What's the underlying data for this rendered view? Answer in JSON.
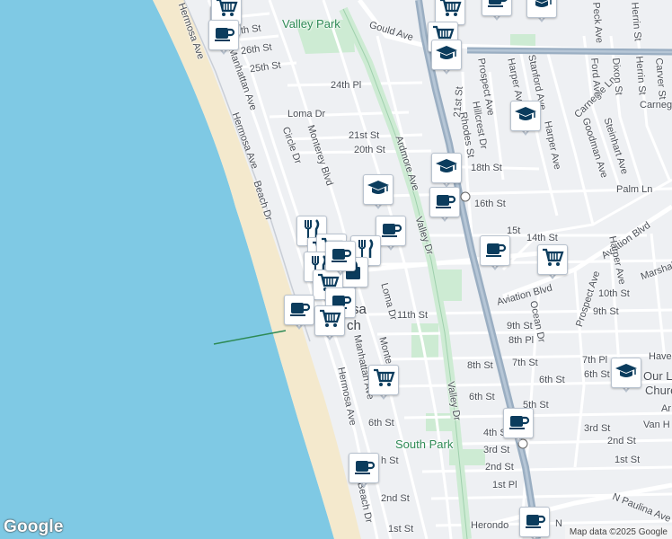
{
  "map": {
    "attribution": "Map data ©2025 Google",
    "logo": "Google",
    "colors": {
      "water": "#7fc9e4",
      "beach": "#f4e9cd",
      "land": "#eef0f3",
      "road": "#ffffff",
      "highway": "#9aaec2",
      "park": "#cdebd3",
      "marker_icon": "#0b3c5d",
      "marker_border": "#b9c3cf"
    },
    "places": {
      "valley_park": "Valley Park",
      "south_park": "South Park",
      "hermosa_beach_part1": "sa",
      "hermosa_beach_part2": "ch",
      "our_lady_church_1": "Our L",
      "our_lady_church_2": "Churc",
      "havel": "Have",
      "van_h": "Van H",
      "ar": "Ar"
    },
    "streets": {
      "hermosa_ave_top": "Hermosa Ave",
      "manhattan_ave_top": "Manhattan Ave",
      "st_27_partial": "th St",
      "st_26": "26th St",
      "st_25": "25th St",
      "gould_ave": "Gould Ave",
      "st_24": "24th Pl",
      "loma_dr_top": "Loma Dr",
      "circle_dr": "Circle Dr",
      "monterey_blvd": "Monterey Blvd",
      "hermosa_ave_mid": "Hermosa Ave",
      "beach_dr_mid": "Beach Dr",
      "st_21": "21st St",
      "st_20": "20th St",
      "ardmore_ave": "Ardmore Ave",
      "valley_dr_top": "Valley Dr",
      "st_21_b": "21st St",
      "hillcrest_dr": "Hillcrest Dr",
      "rhodes_st": "Rhodes St",
      "st_18": "18th St",
      "prospect_ave_top": "Prospect Ave",
      "harper_ave_1": "Harper Ave",
      "stanford_ave": "Stanford Ave",
      "harper_ave_2": "Harper Ave",
      "carnegie_ln": "Carnegie Ln",
      "goodman_ave": "Goodman Ave",
      "steinhart_ave": "Steinhart Ave",
      "ford_ave": "Ford Ave",
      "dixon_st": "Dixon St",
      "herrin_st_1": "Herrin St",
      "herrin_st_2": "Herrin St",
      "carver_st": "Carver St",
      "carnegie_r": "Carnegi",
      "peck_ave": "Peck Ave",
      "st_16": "16th St",
      "palm_ln": "Palm Ln",
      "st_14": "14th St",
      "st_15_partial": "15t",
      "aviation_blvd_1": "Aviation Blvd",
      "harper_ave_3": "Harper Ave",
      "marshall": "Marshal",
      "aviation_blvd_2": "Aviation Blvd",
      "st_10": "10th St",
      "prospect_ave_mid": "Prospect Ave",
      "st_9_r": "9th St",
      "ocean_dr": "Ocean Dr",
      "st_9": "9th St",
      "st_8_pl": "8th Pl",
      "st_11": "11th St",
      "loma_dr_mid": "Loma Dr",
      "monterey_mid": "Monte",
      "manhattan_ave_mid": "Manhattan Ave",
      "hermosa_ave_bot": "Hermosa Ave",
      "st_8": "8th St",
      "st_7": "7th St",
      "st_7_pl": "7th Pl",
      "st_6_a": "6th St",
      "st_6_b": "6th St",
      "st_6_c": "6th St",
      "st_6_d": "6th St",
      "st_5": "5th St",
      "st_4": "4th St",
      "st_3_a": "3rd St",
      "st_3_b": "3rd St",
      "st_2_a": "2nd St",
      "st_2_b": "2nd St",
      "st_2_c": "2nd St",
      "st_1_a": "1st Pl",
      "st_1_b": "1st St",
      "st_1_c": "1st St",
      "st_h_partial": "h St",
      "valley_dr_bot": "Valley Dr",
      "beach_dr_bot": "Beach Dr",
      "herondo": "Herondo",
      "n_paulina": "N Paulina Ave",
      "n_partial": "N"
    }
  },
  "markers": [
    {
      "kind": "cup-icon"
    },
    {
      "kind": "cart-icon"
    },
    {
      "kind": "cup-icon"
    },
    {
      "kind": "cart-icon"
    },
    {
      "kind": "cart-icon"
    },
    {
      "kind": "graduation-cap-icon"
    },
    {
      "kind": "cup-icon"
    },
    {
      "kind": "graduation-cap-icon"
    },
    {
      "kind": "graduation-cap-icon"
    },
    {
      "kind": "graduation-cap-icon"
    },
    {
      "kind": "graduation-cap-icon"
    },
    {
      "kind": "cup-icon"
    },
    {
      "kind": "cup-icon"
    },
    {
      "kind": "cup-icon"
    },
    {
      "kind": "cart-icon"
    },
    {
      "kind": "restaurant-icon"
    },
    {
      "kind": "cart-icon"
    },
    {
      "kind": "cart-icon"
    },
    {
      "kind": "restaurant-icon"
    },
    {
      "kind": "restaurant-icon"
    },
    {
      "kind": "shopping-bag-icon"
    },
    {
      "kind": "cart-icon"
    },
    {
      "kind": "cup-icon"
    },
    {
      "kind": "cup-icon"
    },
    {
      "kind": "cart-icon"
    },
    {
      "kind": "cart-icon"
    },
    {
      "kind": "cup-icon"
    },
    {
      "kind": "graduation-cap-icon"
    },
    {
      "kind": "cup-icon"
    },
    {
      "kind": "cup-icon"
    },
    {
      "kind": "cup-icon"
    }
  ]
}
